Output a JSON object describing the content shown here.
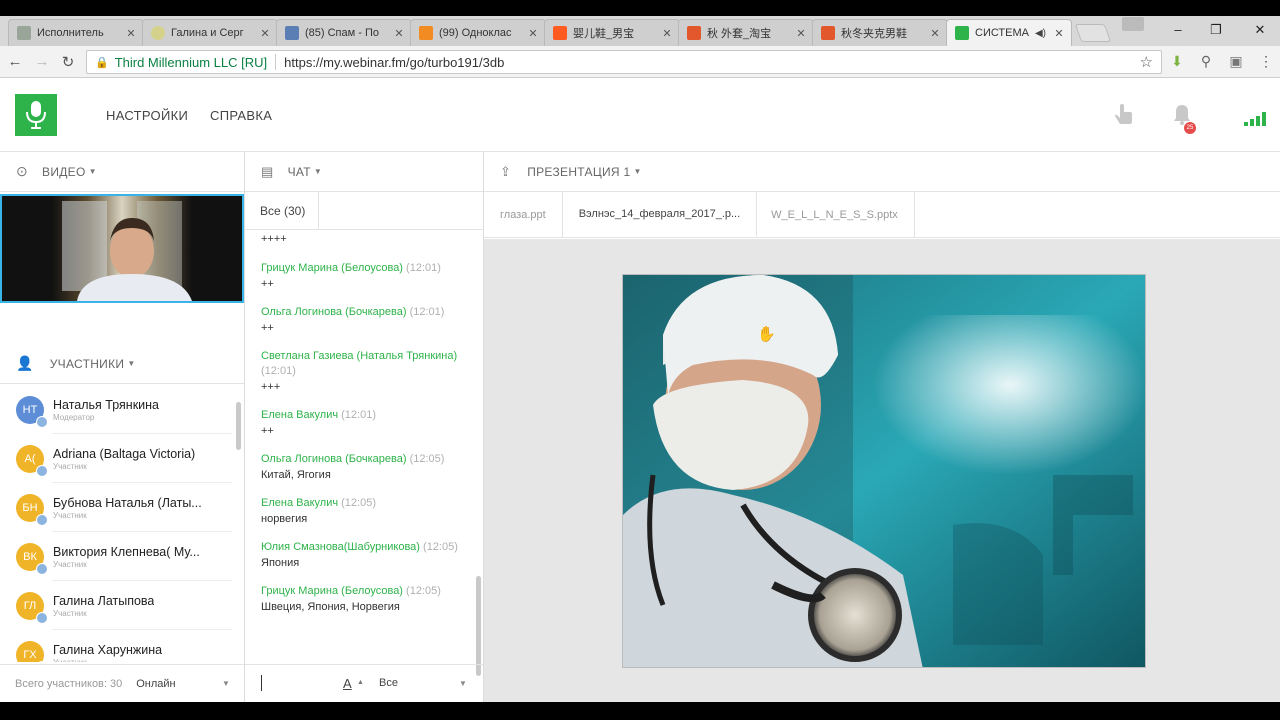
{
  "browser": {
    "tabs": [
      {
        "title": "Исполнитель",
        "fav_color": "#9aa59a",
        "active": false
      },
      {
        "title": "Галина и Серг",
        "fav_color": "#d4d28a",
        "active": false
      },
      {
        "title": "(85) Спам - По",
        "fav_color": "#5b7fb5",
        "active": false
      },
      {
        "title": "(99) Одноклас",
        "fav_color": "#f28b22",
        "active": false
      },
      {
        "title": "婴儿鞋_男宝",
        "fav_color": "#ff5a1f",
        "active": false
      },
      {
        "title": "秋 外套_淘宝",
        "fav_color": "#e2572c",
        "active": false
      },
      {
        "title": "秋冬夹克男鞋",
        "fav_color": "#e2572c",
        "active": false
      },
      {
        "title": "СИСТЕМА",
        "fav_color": "#2eb34a",
        "active": true
      }
    ],
    "tab_close": "✕",
    "secure_label": "Third Millennium LLC [RU]",
    "url": "https://my.webinar.fm/go/turbo191/3db"
  },
  "header": {
    "nav": [
      "НАСТРОЙКИ",
      "СПРАВКА"
    ],
    "notification_count": "25"
  },
  "video_panel": {
    "title": "ВИДЕО"
  },
  "participants": {
    "title": "УЧАСТНИКИ",
    "items": [
      {
        "initials": "НТ",
        "name": "Наталья Трянкина",
        "role": "Модератор",
        "color": "#5c8dd6"
      },
      {
        "initials": "A(",
        "name": "Adriana (Baltaga Victoria)",
        "role": "Участник",
        "color": "#f0b429"
      },
      {
        "initials": "БН",
        "name": "Бубнова Наталья (Латы...",
        "role": "Участник",
        "color": "#f0b429"
      },
      {
        "initials": "ВК",
        "name": "Виктория Клепнева( Му...",
        "role": "Участник",
        "color": "#f0b429"
      },
      {
        "initials": "ГЛ",
        "name": "Галина Латыпова",
        "role": "Участник",
        "color": "#f0b429"
      },
      {
        "initials": "ГХ",
        "name": "Галина Харунжина",
        "role": "Участник",
        "color": "#f0b429"
      }
    ],
    "total_label": "Всего участников: 30",
    "filter": "Онлайн"
  },
  "chat": {
    "title": "ЧАТ",
    "tab_all": "Все (30)",
    "first_text": "++++",
    "messages": [
      {
        "author": "Грицук Марина (Белоусова)",
        "time": "(12:01)",
        "text": "++"
      },
      {
        "author": "Ольга Логинова (Бочкарева)",
        "time": "(12:01)",
        "text": "++"
      },
      {
        "author": "Светлана Газиева (Наталья Трянкина)",
        "time": "(12:01)",
        "text": "+++"
      },
      {
        "author": "Елена Вакулич",
        "time": "(12:01)",
        "text": "++"
      },
      {
        "author": "Ольга Логинова (Бочкарева)",
        "time": "(12:05)",
        "text": "Китай, Ягогия"
      },
      {
        "author": "Елена Вакулич",
        "time": "(12:05)",
        "text": "норвегия"
      },
      {
        "author": "Юлия Смазнова(Шабурникова)",
        "time": "(12:05)",
        "text": "Япония"
      },
      {
        "author": "Грицук Марина (Белоусова)",
        "time": "(12:05)",
        "text": "Швеция, Япония, Норвегия"
      }
    ],
    "font_button": "A",
    "recipient": "Все"
  },
  "presentation": {
    "title": "ПРЕЗЕНТАЦИЯ 1",
    "files": [
      "глаза.ppt",
      "Вэлнэс_14_февраля_2017_.p...",
      "W_E_L_L_N_E_S_S.pptx"
    ]
  }
}
